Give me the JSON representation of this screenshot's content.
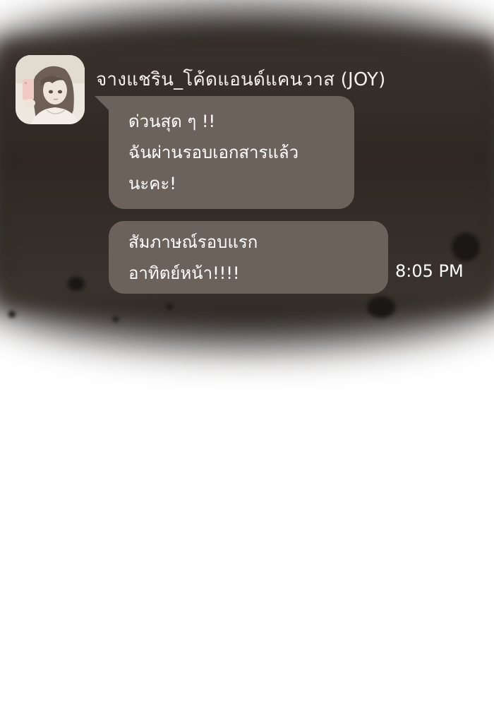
{
  "chat": {
    "sender_name": "จางแชริน_โค้ดแอนด์แคนวาส (JOY)",
    "messages": [
      {
        "lines": [
          "ด่วนสุด ๆ !!",
          "ฉันผ่านรอบเอกสารแล้ว",
          "นะคะ!"
        ]
      },
      {
        "lines": [
          "สัมภาษณ์รอบแรก",
          "อาทิตย์หน้า!!!!"
        ],
        "time": "8:05 PM"
      }
    ]
  },
  "colors": {
    "backdrop": "#2e2824",
    "bubble": "#6b625b",
    "text": "#ffffff",
    "sender_text": "#f4f1ec"
  },
  "icons": {
    "avatar": "profile-photo-girl-with-phone"
  }
}
